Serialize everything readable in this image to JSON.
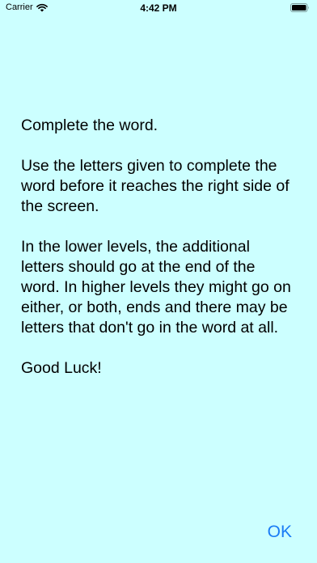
{
  "status_bar": {
    "carrier": "Carrier",
    "time": "4:42 PM",
    "wifi_icon": "wifi-icon",
    "battery_icon": "battery-icon"
  },
  "instructions": {
    "title": "Complete the word.",
    "paragraph_1": "Use the letters given to complete the word before it reaches the right side of the screen.",
    "paragraph_2": "In the lower levels, the additional letters should go at the end of the word. In higher levels they might go on either, or both, ends and there may be letters that don't go in the word at all.",
    "closing": "Good Luck!"
  },
  "ok_button": {
    "label": "OK"
  },
  "colors": {
    "background": "#ccffff",
    "accent": "#1a7cf5"
  }
}
